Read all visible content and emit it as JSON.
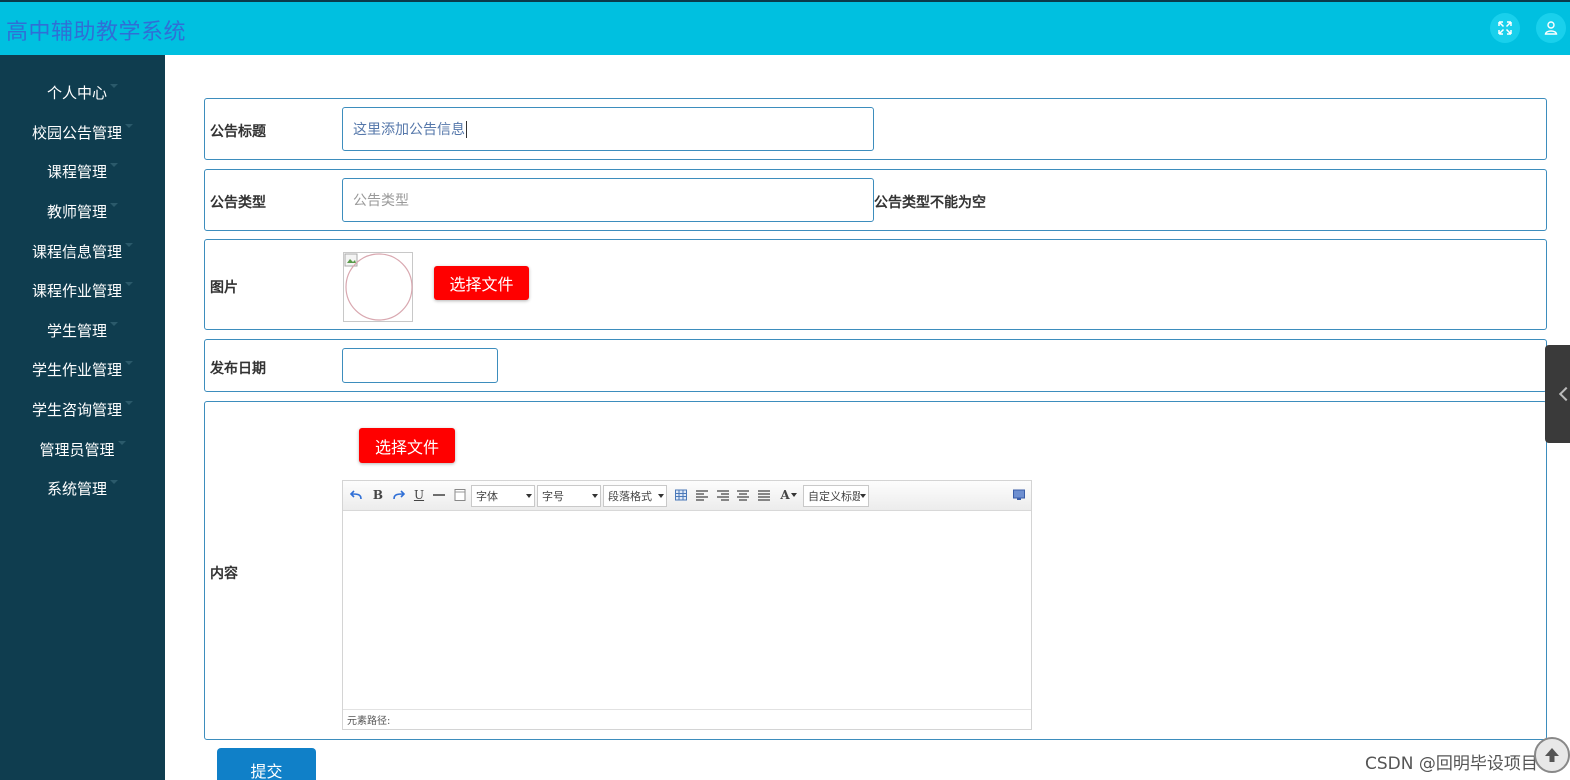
{
  "header": {
    "app_title": "高中辅助教学系统",
    "bg_color": "#00c0e0",
    "buttons": [
      "fullscreen-icon",
      "user-icon"
    ]
  },
  "sidebar": {
    "bg_color": "#0f3d4f",
    "items": [
      {
        "label": "个人中心"
      },
      {
        "label": "校园公告管理"
      },
      {
        "label": "课程管理"
      },
      {
        "label": "教师管理"
      },
      {
        "label": "课程信息管理"
      },
      {
        "label": "课程作业管理"
      },
      {
        "label": "学生管理"
      },
      {
        "label": "学生作业管理"
      },
      {
        "label": "学生咨询管理"
      },
      {
        "label": "管理员管理"
      },
      {
        "label": "系统管理"
      }
    ]
  },
  "form": {
    "title": {
      "label": "公告标题",
      "value": "这里添加公告信息"
    },
    "type": {
      "label": "公告类型",
      "placeholder": "公告类型",
      "error": "公告类型不能为空"
    },
    "image": {
      "label": "图片",
      "button": "选择文件"
    },
    "date": {
      "label": "发布日期",
      "value": ""
    },
    "content": {
      "label": "内容",
      "button": "选择文件",
      "toolbar": {
        "font_select": "字体",
        "size_select": "字号",
        "paragraph_select": "段落格式",
        "custom_select": "自定义标题",
        "bold": "B",
        "underline": "U",
        "font_color": "A"
      },
      "status": "元素路径:"
    },
    "submit": "提交"
  },
  "watermark": "CSDN @回明毕设项目",
  "colors": {
    "accent": "#3d8dbd",
    "danger": "#ff0000",
    "primary": "#1080c8"
  }
}
